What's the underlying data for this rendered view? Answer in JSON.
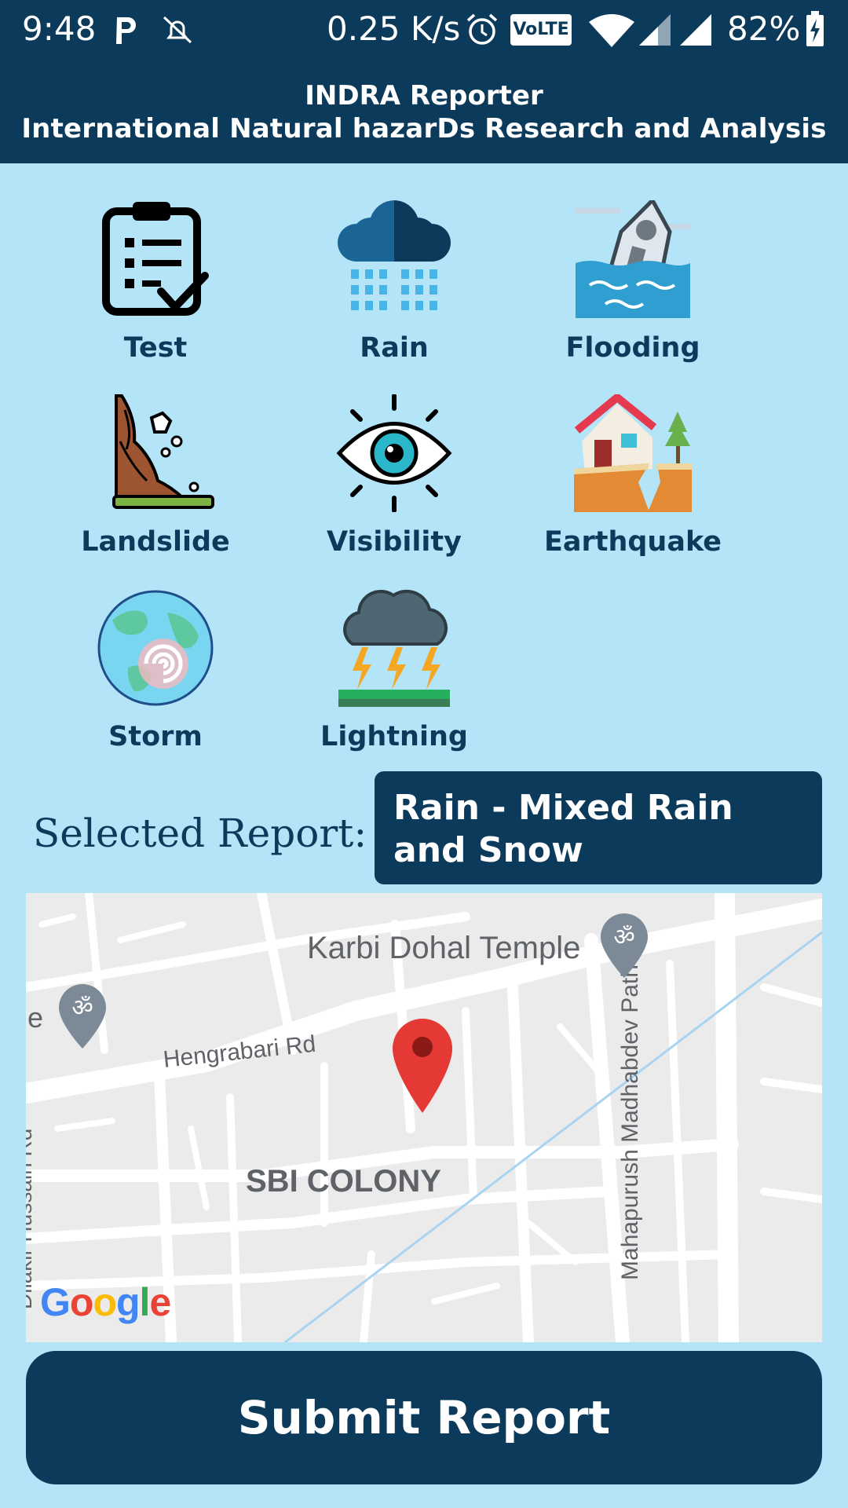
{
  "status_bar": {
    "time": "9:48",
    "speed": "0.25 K/s",
    "volte": "VoLTE",
    "battery": "82%",
    "icons": [
      "parking-p-icon",
      "notifications-off-icon",
      "alarm-icon",
      "volte-icon",
      "wifi-icon",
      "signal-icon",
      "signal-icon",
      "battery-charging-icon"
    ]
  },
  "header": {
    "title": "INDRA Reporter",
    "subtitle": "International Natural hazarDs Research and Analysis"
  },
  "hazards": [
    {
      "label": "Test",
      "icon": "clipboard-checklist-icon"
    },
    {
      "label": "Rain",
      "icon": "rain-cloud-icon"
    },
    {
      "label": "Flooding",
      "icon": "flooded-house-icon"
    },
    {
      "label": "Landslide",
      "icon": "landslide-icon"
    },
    {
      "label": "Visibility",
      "icon": "eye-icon"
    },
    {
      "label": "Earthquake",
      "icon": "earthquake-house-icon"
    },
    {
      "label": "Storm",
      "icon": "cyclone-globe-icon"
    },
    {
      "label": "Lightning",
      "icon": "lightning-cloud-icon"
    }
  ],
  "selected": {
    "label": "Selected Report:",
    "value": "Rain - Mixed Rain and Snow"
  },
  "map": {
    "temple": "Karbi Dohal Temple",
    "road_hengrabari": "Hengrabari Rd",
    "area": "SBI COLONY",
    "road_mahapurush": "Mahapurush Madhabdev Path",
    "road_hussain": "Dilakir Hussain Rd",
    "partial_left": "le",
    "google": "Google"
  },
  "submit_label": "Submit Report",
  "colors": {
    "primary": "#0b3a5b",
    "background": "#b3e4f8",
    "pin": "#e53935"
  }
}
